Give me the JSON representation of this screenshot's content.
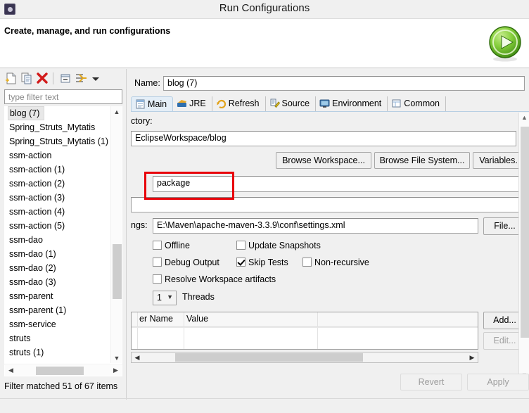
{
  "window": {
    "title": "Run Configurations",
    "icon": "eclipse-run-icon"
  },
  "header": {
    "title": "Create, manage, and run configurations",
    "badge_icon": "green-run-play-icon"
  },
  "sidebar": {
    "toolbar": [
      {
        "name": "new-launch-configuration",
        "icon": "new-document-icon"
      },
      {
        "name": "duplicate-launch-configuration",
        "icon": "copy-icon"
      },
      {
        "name": "delete-launch-configuration",
        "icon": "red-x-delete-icon"
      },
      {
        "name": "collapse-all",
        "icon": "collapse-all-icon"
      },
      {
        "name": "filter-configurations",
        "icon": "filter-icon"
      },
      {
        "name": "view-menu",
        "icon": "chevron-down-icon"
      }
    ],
    "filter": {
      "placeholder": "type filter text",
      "value": ""
    },
    "items": [
      {
        "label": "blog (7)",
        "selected": true
      },
      {
        "label": "Spring_Struts_Mytatis",
        "selected": false
      },
      {
        "label": "Spring_Struts_Mytatis (1)",
        "selected": false
      },
      {
        "label": "ssm-action",
        "selected": false
      },
      {
        "label": "ssm-action (1)",
        "selected": false
      },
      {
        "label": "ssm-action (2)",
        "selected": false
      },
      {
        "label": "ssm-action (3)",
        "selected": false
      },
      {
        "label": "ssm-action (4)",
        "selected": false
      },
      {
        "label": "ssm-action (5)",
        "selected": false
      },
      {
        "label": "ssm-dao",
        "selected": false
      },
      {
        "label": "ssm-dao (1)",
        "selected": false
      },
      {
        "label": "ssm-dao (2)",
        "selected": false
      },
      {
        "label": "ssm-dao (3)",
        "selected": false
      },
      {
        "label": "ssm-parent",
        "selected": false
      },
      {
        "label": "ssm-parent (1)",
        "selected": false
      },
      {
        "label": "ssm-service",
        "selected": false
      },
      {
        "label": "struts",
        "selected": false
      },
      {
        "label": "struts (1)",
        "selected": false
      }
    ],
    "status": "Filter matched 51 of 67 items"
  },
  "main": {
    "name_label": "Name:",
    "name_value": "blog (7)",
    "tabs": [
      {
        "label": "Main",
        "icon": "main-tab-icon",
        "active": true
      },
      {
        "label": "JRE",
        "icon": "jre-tab-icon",
        "active": false
      },
      {
        "label": "Refresh",
        "icon": "refresh-tab-icon",
        "active": false
      },
      {
        "label": "Source",
        "icon": "source-tab-icon",
        "active": false
      },
      {
        "label": "Environment",
        "icon": "environment-tab-icon",
        "active": false
      },
      {
        "label": "Common",
        "icon": "common-tab-icon",
        "active": false
      }
    ],
    "base_directory_label": "ctory:",
    "base_directory_value": "EclipseWorkspace/blog",
    "browse_workspace_label": "Browse Workspace...",
    "browse_file_system_label": "Browse File System...",
    "variables_label": "Variables...",
    "goals_value": "package",
    "profiles_value": "",
    "settings_label": "ngs:",
    "settings_value": "E:\\Maven\\apache-maven-3.3.9\\conf\\settings.xml",
    "file_button_label": "File...",
    "checkboxes": [
      {
        "label": "Offline",
        "checked": false
      },
      {
        "label": "Update Snapshots",
        "checked": false
      },
      {
        "label": "Debug Output",
        "checked": false
      },
      {
        "label": "Skip Tests",
        "checked": true
      },
      {
        "label": "Non-recursive",
        "checked": false
      },
      {
        "label": "Resolve Workspace artifacts",
        "checked": false
      }
    ],
    "threads_value": "1",
    "threads_label": "Threads",
    "parameters_table": {
      "columns": [
        "er Name",
        "Value"
      ],
      "rows": []
    },
    "add_label": "Add...",
    "edit_label": "Edit..."
  },
  "footer": {
    "revert_label": "Revert",
    "apply_label": "Apply"
  },
  "colors": {
    "accent_red": "#e8000a",
    "tab_active_bg": "#e4eef7",
    "run_green": "#62b81f"
  }
}
